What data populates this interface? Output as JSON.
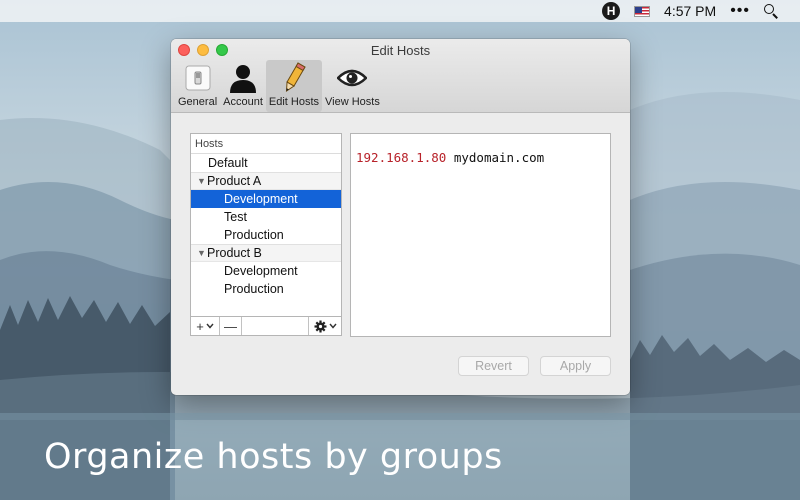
{
  "menubar": {
    "app_icon_letter": "H",
    "flag": "us-flag-icon",
    "time": "4:57 PM",
    "more": "•••",
    "search_icon": "search-icon"
  },
  "window": {
    "title": "Edit Hosts",
    "toolbar": [
      {
        "label": "General",
        "icon": "switch-icon",
        "active": false
      },
      {
        "label": "Account",
        "icon": "person-icon",
        "active": false
      },
      {
        "label": "Edit Hosts",
        "icon": "pencil-icon",
        "active": true
      },
      {
        "label": "View Hosts",
        "icon": "eye-icon",
        "active": false
      }
    ],
    "hosts_list": {
      "header": "Hosts",
      "items": [
        {
          "label": "Default",
          "type": "item",
          "indent": 1
        },
        {
          "label": "Product A",
          "type": "group"
        },
        {
          "label": "Development",
          "type": "item",
          "indent": 2,
          "selected": true
        },
        {
          "label": "Test",
          "type": "item",
          "indent": 2
        },
        {
          "label": "Production",
          "type": "item",
          "indent": 2
        },
        {
          "label": "Product B",
          "type": "group"
        },
        {
          "label": "Development",
          "type": "item",
          "indent": 2
        },
        {
          "label": "Production",
          "type": "item",
          "indent": 2
        }
      ],
      "footer": {
        "add": "+",
        "add_menu": "chevron-down-icon",
        "remove": "—",
        "gear": "gear-icon"
      }
    },
    "editor": {
      "ip": "192.168.1.80",
      "domain": "mydomain.com"
    },
    "buttons": {
      "revert": "Revert",
      "apply": "Apply"
    }
  },
  "caption": "Organize hosts by groups",
  "colors": {
    "selection": "#1363d8",
    "ip_text": "#b8222a"
  }
}
